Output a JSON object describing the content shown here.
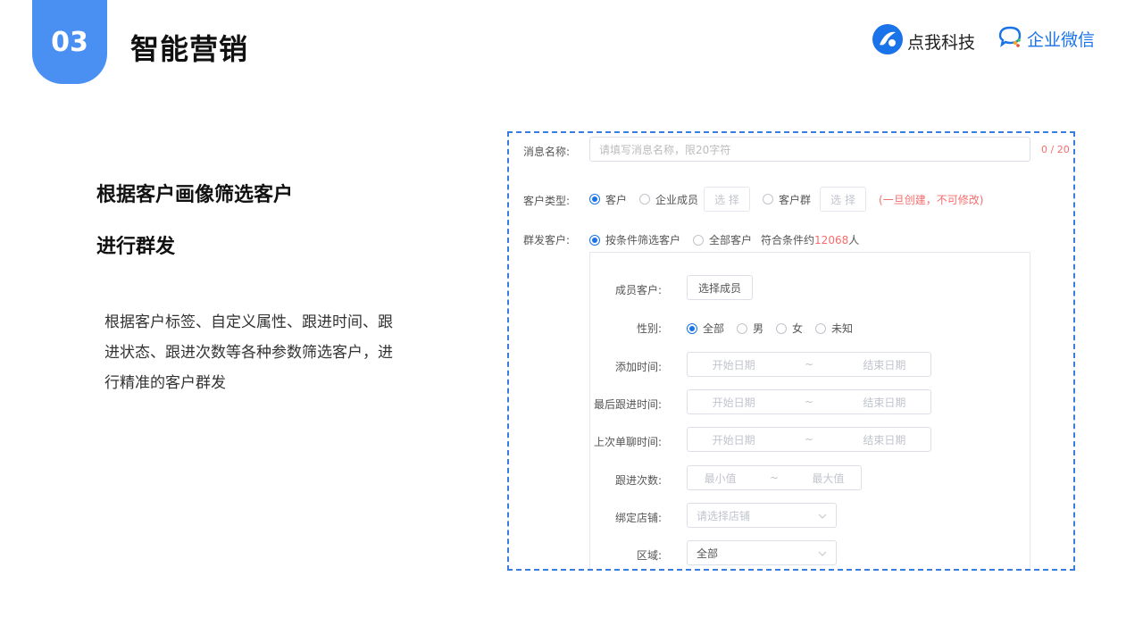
{
  "header": {
    "number": "03",
    "title": "智能营销",
    "brand1": "点我科技",
    "brand2": "企业微信",
    "colors": {
      "accent": "#4a8ff2",
      "link": "#1a73e8",
      "warning": "#f56c6c"
    }
  },
  "left": {
    "headline1": "根据客户画像筛选客户",
    "headline2": "进行群发",
    "description": "根据客户标签、自定义属性、跟进时间、跟进状态、跟进次数等各种参数筛选客户，进行精准的客户群发"
  },
  "form": {
    "msg_name_label": "消息名称:",
    "msg_name_placeholder": "请填写消息名称，限20字符",
    "msg_name_counter": "0 / 20",
    "customer_type_label": "客户类型:",
    "customer_type_options": [
      "客户",
      "企业成员",
      "客户群"
    ],
    "select_btn": "选 择",
    "customer_type_note": "(一旦创建，不可修改)",
    "send_label": "群发客户:",
    "send_options": [
      "按条件筛选客户",
      "全部客户"
    ],
    "match_prefix": "符合条件约",
    "match_count": "12068",
    "match_suffix": "人",
    "filters": {
      "member_label": "成员客户:",
      "member_btn": "选择成员",
      "gender_label": "性别:",
      "gender_options": [
        "全部",
        "男",
        "女",
        "未知"
      ],
      "add_time_label": "添加时间:",
      "last_follow_label": "最后跟进时间:",
      "last_chat_label": "上次单聊时间:",
      "start_date": "开始日期",
      "end_date": "结束日期",
      "tilde": "~",
      "follow_count_label": "跟进次数:",
      "min": "最小值",
      "max": "最大值",
      "store_label": "绑定店铺:",
      "store_placeholder": "请选择店铺",
      "region_label": "区域:",
      "region_value": "全部"
    }
  }
}
